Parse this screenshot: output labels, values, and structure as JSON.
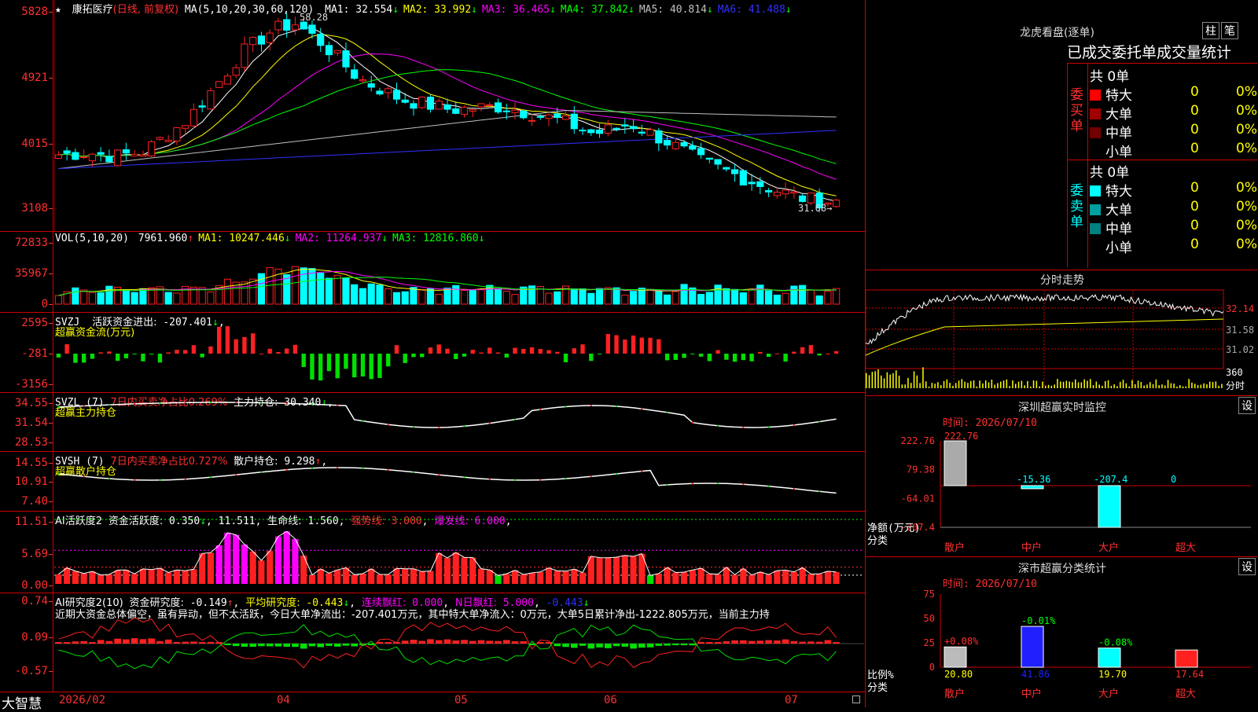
{
  "app": {
    "brand": "大智慧"
  },
  "price_panel": {
    "star": "★",
    "stock_name": "康拓医疗",
    "period": "(日线, 前复权)",
    "ma_params": "MA(5,10,20,30,60,120)",
    "items": [
      {
        "label": "MA1:",
        "value": "32.554",
        "arrow": "↓",
        "color": "#ffffff"
      },
      {
        "label": "MA2:",
        "value": "33.992",
        "arrow": "↓",
        "color": "#ffff00"
      },
      {
        "label": "MA3:",
        "value": "36.465",
        "arrow": "↓",
        "color": "#ff00ff"
      },
      {
        "label": "MA4:",
        "value": "37.842",
        "arrow": "↓",
        "color": "#00ff00"
      },
      {
        "label": "MA5:",
        "value": "40.814",
        "arrow": "↓",
        "color": "#c0c0c0"
      },
      {
        "label": "MA6:",
        "value": "41.488",
        "arrow": "↓",
        "color": "#3030ff"
      }
    ],
    "ticks": [
      "5828",
      "4921",
      "4015",
      "3108"
    ],
    "high_label": "58.28",
    "low_label": "31.08"
  },
  "vol_panel": {
    "header": "VOL(5,10,20)",
    "value": "7961.960",
    "arrow": "↑",
    "items": [
      {
        "label": "MA1:",
        "value": "10247.446",
        "arrow": "↓",
        "color": "#ffff00"
      },
      {
        "label": "MA2:",
        "value": "11264.937",
        "arrow": "↓",
        "color": "#ff00ff"
      },
      {
        "label": "MA3:",
        "value": "12816.860",
        "arrow": "↓",
        "color": "#00ff00"
      }
    ],
    "ticks": [
      "72833",
      "35967",
      "0"
    ]
  },
  "svzj_panel": {
    "header": "SVZJ",
    "label": "活跃资金进出:",
    "value": "-207.401",
    "arrow": "↓",
    "subtitle": "超赢资金流(万元)",
    "ticks": [
      "2595",
      "-281",
      "-3156"
    ]
  },
  "svzl_panel": {
    "header": "SVZL (7)",
    "ratio": "7日内买卖净占比0.269%",
    "label": "主力持仓:",
    "value": "30.340",
    "arrow": "↓",
    "subtitle": "超赢主力持仓",
    "ticks": [
      "34.55",
      "31.54",
      "28.53"
    ]
  },
  "svsh_panel": {
    "header": "SVSH (7)",
    "ratio": "7日内买卖净占比0.727%",
    "label": "散户持仓:",
    "value": "9.298",
    "arrow": "↑",
    "subtitle": "超赢散户持仓",
    "ticks": [
      "14.55",
      "10.91",
      "7.40"
    ]
  },
  "ai_panel": {
    "header": "AI活跃度2",
    "label": "资金活跃度:",
    "value": "0.350",
    "arrow": "↓",
    "v2": "11.511",
    "label3": "生命线:",
    "v3": "1.560",
    "label4": "强势线:",
    "v4": "3.000",
    "label5": "爆发线:",
    "v5": "6.000",
    "ticks": [
      "11.51",
      "5.69",
      "0.00"
    ]
  },
  "research_panel": {
    "header": "AI研究度2(10)",
    "label1": "资金研究度:",
    "v1": "-0.149",
    "a1": "↑",
    "label2": "平均研究度:",
    "v2": "-0.443",
    "a2": "↓",
    "label3": "连续飘红:",
    "v3": "0.000",
    "label4": "N日飘红:",
    "v4": "5.000",
    "v5": "-0.443",
    "a5": "↓",
    "commentary": "近期大资金总体偏空，虽有异动，但不太活跃，今日大单净流出：-207.401万元，其中特大单净流入：0万元，大单5日累计净出-1222.805万元，当前主力持",
    "ticks": [
      "0.74",
      "0.09",
      "-0.57"
    ]
  },
  "date_axis": {
    "labels": [
      "2026/02",
      "04",
      "05",
      "06",
      "07"
    ]
  },
  "dragon": {
    "title": "龙虎看盘(逐单)",
    "btn1": "柱",
    "btn2": "笔",
    "subtitle": "已成交委托单成交量统计",
    "buy": {
      "side_label": "委买单",
      "total": "共 0单",
      "rows": [
        {
          "name": "特大",
          "count": "0",
          "pct": "0%",
          "color": "#ff0000"
        },
        {
          "name": "大单",
          "count": "0",
          "pct": "0%",
          "color": "#a00000"
        },
        {
          "name": "中单",
          "count": "0",
          "pct": "0%",
          "color": "#700000"
        },
        {
          "name": "小单",
          "count": "0",
          "pct": "0%",
          "color": ""
        }
      ]
    },
    "sell": {
      "side_label": "委卖单",
      "total": "共 0单",
      "rows": [
        {
          "name": "特大",
          "count": "0",
          "pct": "0%",
          "color": "#00ffff"
        },
        {
          "name": "大单",
          "count": "0",
          "pct": "0%",
          "color": "#00a0a0"
        },
        {
          "name": "中单",
          "count": "0",
          "pct": "0%",
          "color": "#008080"
        },
        {
          "name": "小单",
          "count": "0",
          "pct": "0%",
          "color": ""
        }
      ]
    }
  },
  "intraday": {
    "title": "分时走势",
    "ticks": [
      "32.14",
      "31.58",
      "31.02"
    ],
    "vol_tick": "360",
    "vol_label": "分时"
  },
  "monitor": {
    "title": "深圳超赢实时监控",
    "settings": "设",
    "time": "时间: 2026/07/10",
    "ylabel": "净额(万元)",
    "xlabel": "分类",
    "ticks": [
      "222.76",
      "79.38",
      "-64.01",
      "-207.4"
    ],
    "chart_data": {
      "type": "bar",
      "categories": [
        "散户",
        "中户",
        "大户",
        "超大"
      ],
      "values": [
        222.76,
        -15.36,
        -207.4,
        0
      ],
      "labels": [
        "222.76",
        "-15.36",
        "-207.4",
        "0"
      ],
      "ylim": [
        -207.4,
        222.76
      ]
    }
  },
  "market_stats": {
    "title": "深市超赢分类统计",
    "settings": "设",
    "time": "时间: 2026/07/10",
    "ylabel": "比例%",
    "xlabel": "分类",
    "ticks": [
      "75",
      "50",
      "25",
      "0"
    ],
    "chart_data": {
      "type": "bar",
      "categories": [
        "散户",
        "中户",
        "大户",
        "超大"
      ],
      "values": [
        20.8,
        41.86,
        19.7,
        17.64
      ],
      "value_labels": [
        "20.80",
        "41.86",
        "19.70",
        "17.64"
      ],
      "changes": [
        "+0.08%",
        "-0.01%",
        "-0.08%",
        ""
      ],
      "ylim": [
        0,
        75
      ]
    }
  },
  "colors": {
    "up": "#ff2020",
    "down": "#00ffff",
    "grid": "#c00000",
    "label": "#ff3030"
  }
}
